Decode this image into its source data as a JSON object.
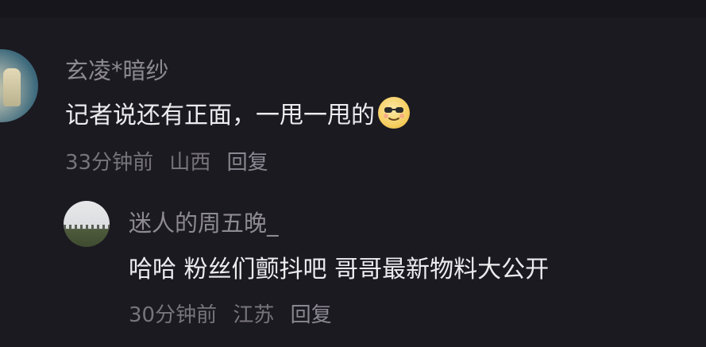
{
  "comments": [
    {
      "username": "玄凌*暗纱",
      "text": "记者说还有正面，一甩一甩的",
      "emoji": "smug-glasses-emoji",
      "time": "33分钟前",
      "location": "山西",
      "reply_label": "回复"
    },
    {
      "username": "迷人的周五晚_",
      "text": "哈哈 粉丝们颤抖吧 哥哥最新物料大公开",
      "time": "30分钟前",
      "location": "江苏",
      "reply_label": "回复"
    }
  ]
}
